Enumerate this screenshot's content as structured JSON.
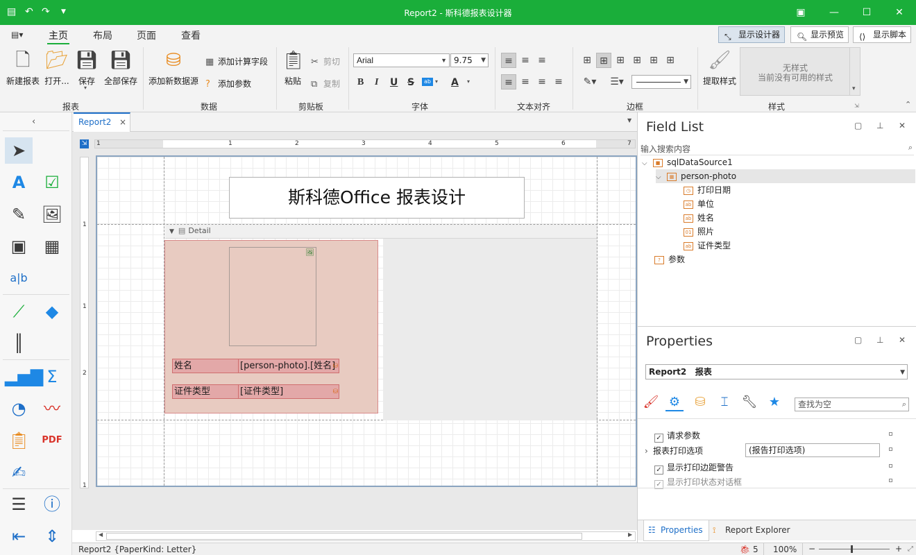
{
  "app": {
    "title": "Report2 - 斯科德报表设计器"
  },
  "ribbon_tabs": [
    "主页",
    "布局",
    "页面",
    "查看"
  ],
  "top_buttons": {
    "designer": "显示设计器",
    "preview": "显示预览",
    "script": "显示脚本"
  },
  "groups": {
    "report": {
      "label": "报表",
      "new": "新建报表",
      "open": "打开...",
      "save": "保存",
      "save_all": "全部保存"
    },
    "data": {
      "label": "数据",
      "add_source": "添加新数据源",
      "add_calc": "添加计算字段",
      "add_param": "添加参数"
    },
    "clipboard": {
      "label": "剪贴板",
      "paste": "粘贴",
      "cut": "剪切",
      "copy": "复制"
    },
    "font": {
      "label": "字体",
      "family": "Arial",
      "size": "9.75"
    },
    "align": {
      "label": "文本对齐"
    },
    "border": {
      "label": "边框"
    },
    "style": {
      "label": "样式",
      "extract": "提取样式",
      "empty_line1": "无样式",
      "empty_line2": "当前没有可用的样式"
    }
  },
  "document": {
    "tab": "Report2",
    "title_text": "斯科德Office 报表设计",
    "detail_band": "Detail",
    "rows": [
      {
        "label": "姓名",
        "value": "[person-photo].[姓名]"
      },
      {
        "label": "证件类型",
        "value": "[证件类型]"
      }
    ],
    "ruler_h": [
      "1",
      "1",
      "2",
      "3",
      "4",
      "5",
      "6",
      "7"
    ],
    "ruler_v": [
      "1",
      "1",
      "2",
      "1"
    ]
  },
  "field_list": {
    "title": "Field List",
    "search_placeholder": "输入搜索内容",
    "datasource": "sqlDataSource1",
    "table": "person-photo",
    "fields": [
      "打印日期",
      "单位",
      "姓名",
      "照片",
      "证件类型"
    ],
    "params": "参数"
  },
  "properties": {
    "title": "Properties",
    "selected": "Report2",
    "selected_type": "报表",
    "search_placeholder": "查找为空",
    "rows": [
      {
        "label": "请求参数",
        "value": ""
      },
      {
        "label": "报表打印选项",
        "value": "(报告打印选项)"
      },
      {
        "label": "显示打印边距警告",
        "value": ""
      },
      {
        "label": "显示打印状态对话框",
        "value": ""
      }
    ],
    "tabs": [
      "Properties",
      "Report Explorer"
    ]
  },
  "status": {
    "paper": "Report2 {PaperKind: Letter}",
    "errors": "5",
    "zoom": "100%"
  }
}
